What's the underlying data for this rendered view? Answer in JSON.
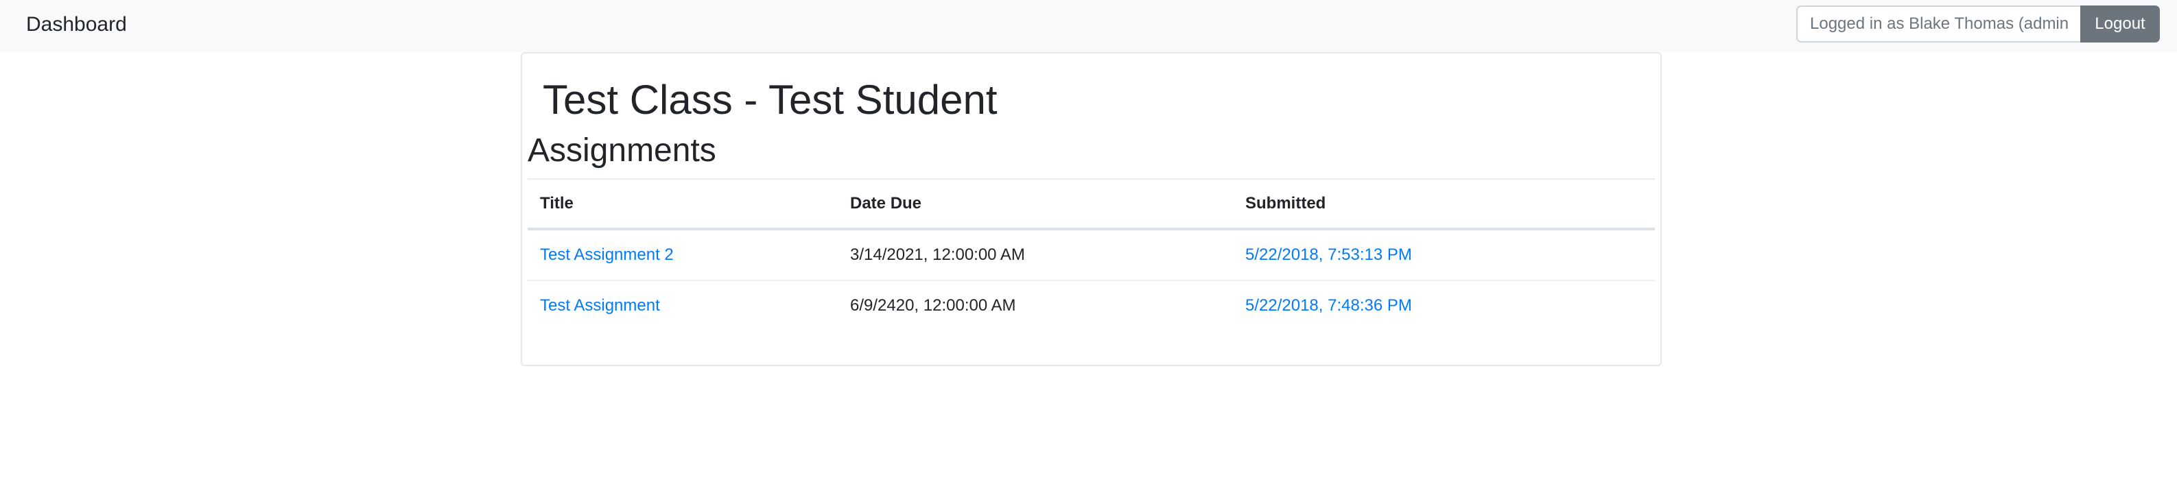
{
  "navbar": {
    "brand": "Dashboard",
    "user_placeholder": "Logged in as Blake Thomas (admin)",
    "logout_label": "Logout"
  },
  "main": {
    "title": "Test Class - Test Student",
    "section_title": "Assignments",
    "table": {
      "headers": {
        "title": "Title",
        "date_due": "Date Due",
        "submitted": "Submitted"
      },
      "rows": [
        {
          "title": "Test Assignment 2",
          "date_due": "3/14/2021, 12:00:00 AM",
          "submitted": "5/22/2018, 7:53:13 PM"
        },
        {
          "title": "Test Assignment",
          "date_due": "6/9/2420, 12:00:00 AM",
          "submitted": "5/22/2018, 7:48:36 PM"
        }
      ]
    }
  },
  "colors": {
    "link": "#007bff",
    "navbar_bg": "#f8f9fa",
    "button_secondary": "#6c757d"
  }
}
